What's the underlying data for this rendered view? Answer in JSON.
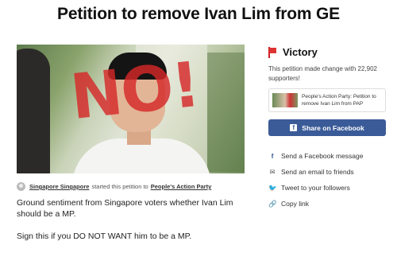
{
  "page": {
    "title": "Petition to remove Ivan Lim from GE"
  },
  "hero": {
    "overlay_text": "NO!"
  },
  "starter": {
    "name": "Singapore Singapore",
    "middle": "started this petition to",
    "target": "People's Action Party"
  },
  "description": {
    "para1": "Ground sentiment from Singapore voters whether Ivan Lim should be a MP.",
    "para2": "Sign this if you DO NOT WANT him to be a MP."
  },
  "sidebar": {
    "victory_label": "Victory",
    "victory_text": "This petition made change with 22,902 supporters!",
    "card_text": "People's Action Party: Petition to remove Ivan Lim from PAP",
    "fb_button": "Share on Facebook",
    "share_items": [
      {
        "label": "Send a Facebook message",
        "icon": "facebook-messenger-icon"
      },
      {
        "label": "Send an email to friends",
        "icon": "email-icon"
      },
      {
        "label": "Tweet to your followers",
        "icon": "twitter-icon"
      },
      {
        "label": "Copy link",
        "icon": "link-icon"
      }
    ]
  },
  "colors": {
    "facebook": "#3b5b98",
    "victory_flag": "#dd3333",
    "overlay": "#d62828"
  }
}
